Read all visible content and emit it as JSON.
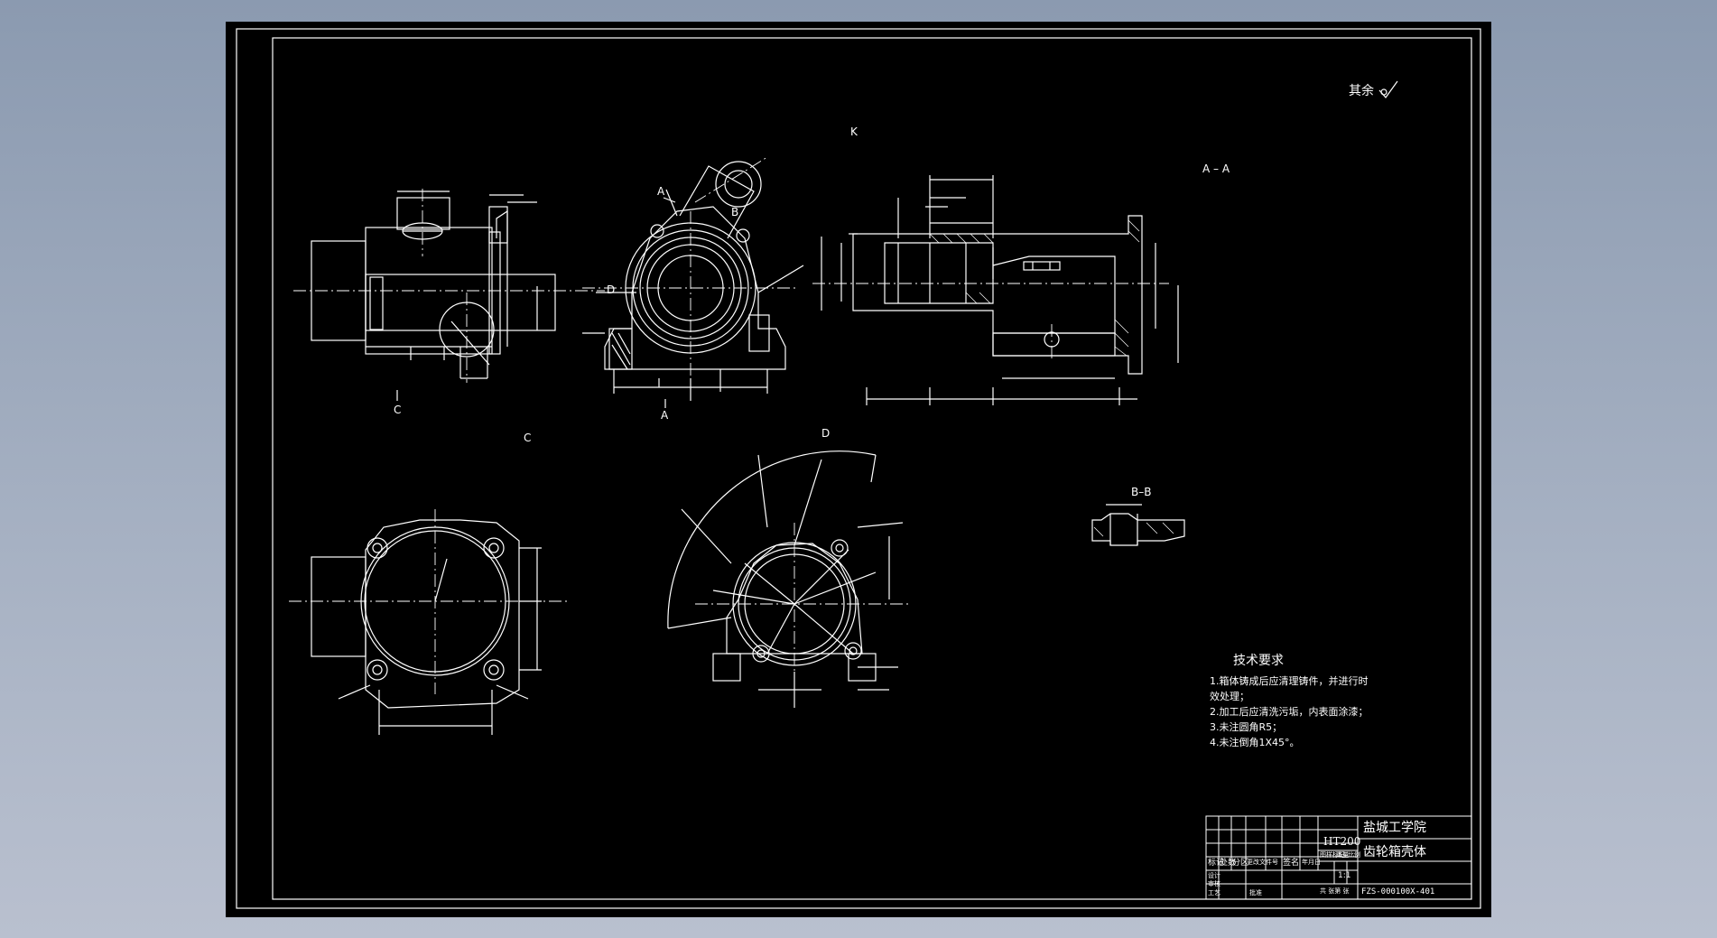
{
  "viewer": {
    "background_top": "#8b9ab0",
    "background_bottom": "#b9c0cf"
  },
  "sheet": {
    "background": "#000000",
    "line_color": "#ffffff"
  },
  "roughness_note": "其余",
  "views": {
    "view_k": "K",
    "section_aa": "A – A",
    "view_c": "C",
    "view_d": "D",
    "section_bb": "B–B",
    "mark_a_top": "A",
    "mark_a_bottom": "A",
    "mark_b": "B",
    "mark_c_arrow": "C",
    "mark_d_arrow": "D"
  },
  "tech_requirements": {
    "title": "技术要求",
    "items": [
      "1.箱体铸成后应清理铸件，并进行时",
      "效处理；",
      "2.加工后应清洗污垢，内表面涂漆；",
      "3.未注圆角R5；",
      "4.未注倒角1X45°。"
    ]
  },
  "title_block": {
    "material": "HT200",
    "school": "盐城工学院",
    "part_name": "齿轮箱壳体",
    "scale": "1:1",
    "drawing_no": "FZS-000100X-401",
    "headers": {
      "mark": "标记",
      "count": "处数",
      "zone": "分区",
      "doc_no": "更改文件号",
      "sign": "签名",
      "date": "年月日",
      "stage": "图样标记",
      "weight": "重量",
      "ratio": "比例",
      "designer": "设计",
      "checker": "审核",
      "process": "工艺",
      "approve": "批准",
      "sheets": "共  张第  张"
    }
  }
}
